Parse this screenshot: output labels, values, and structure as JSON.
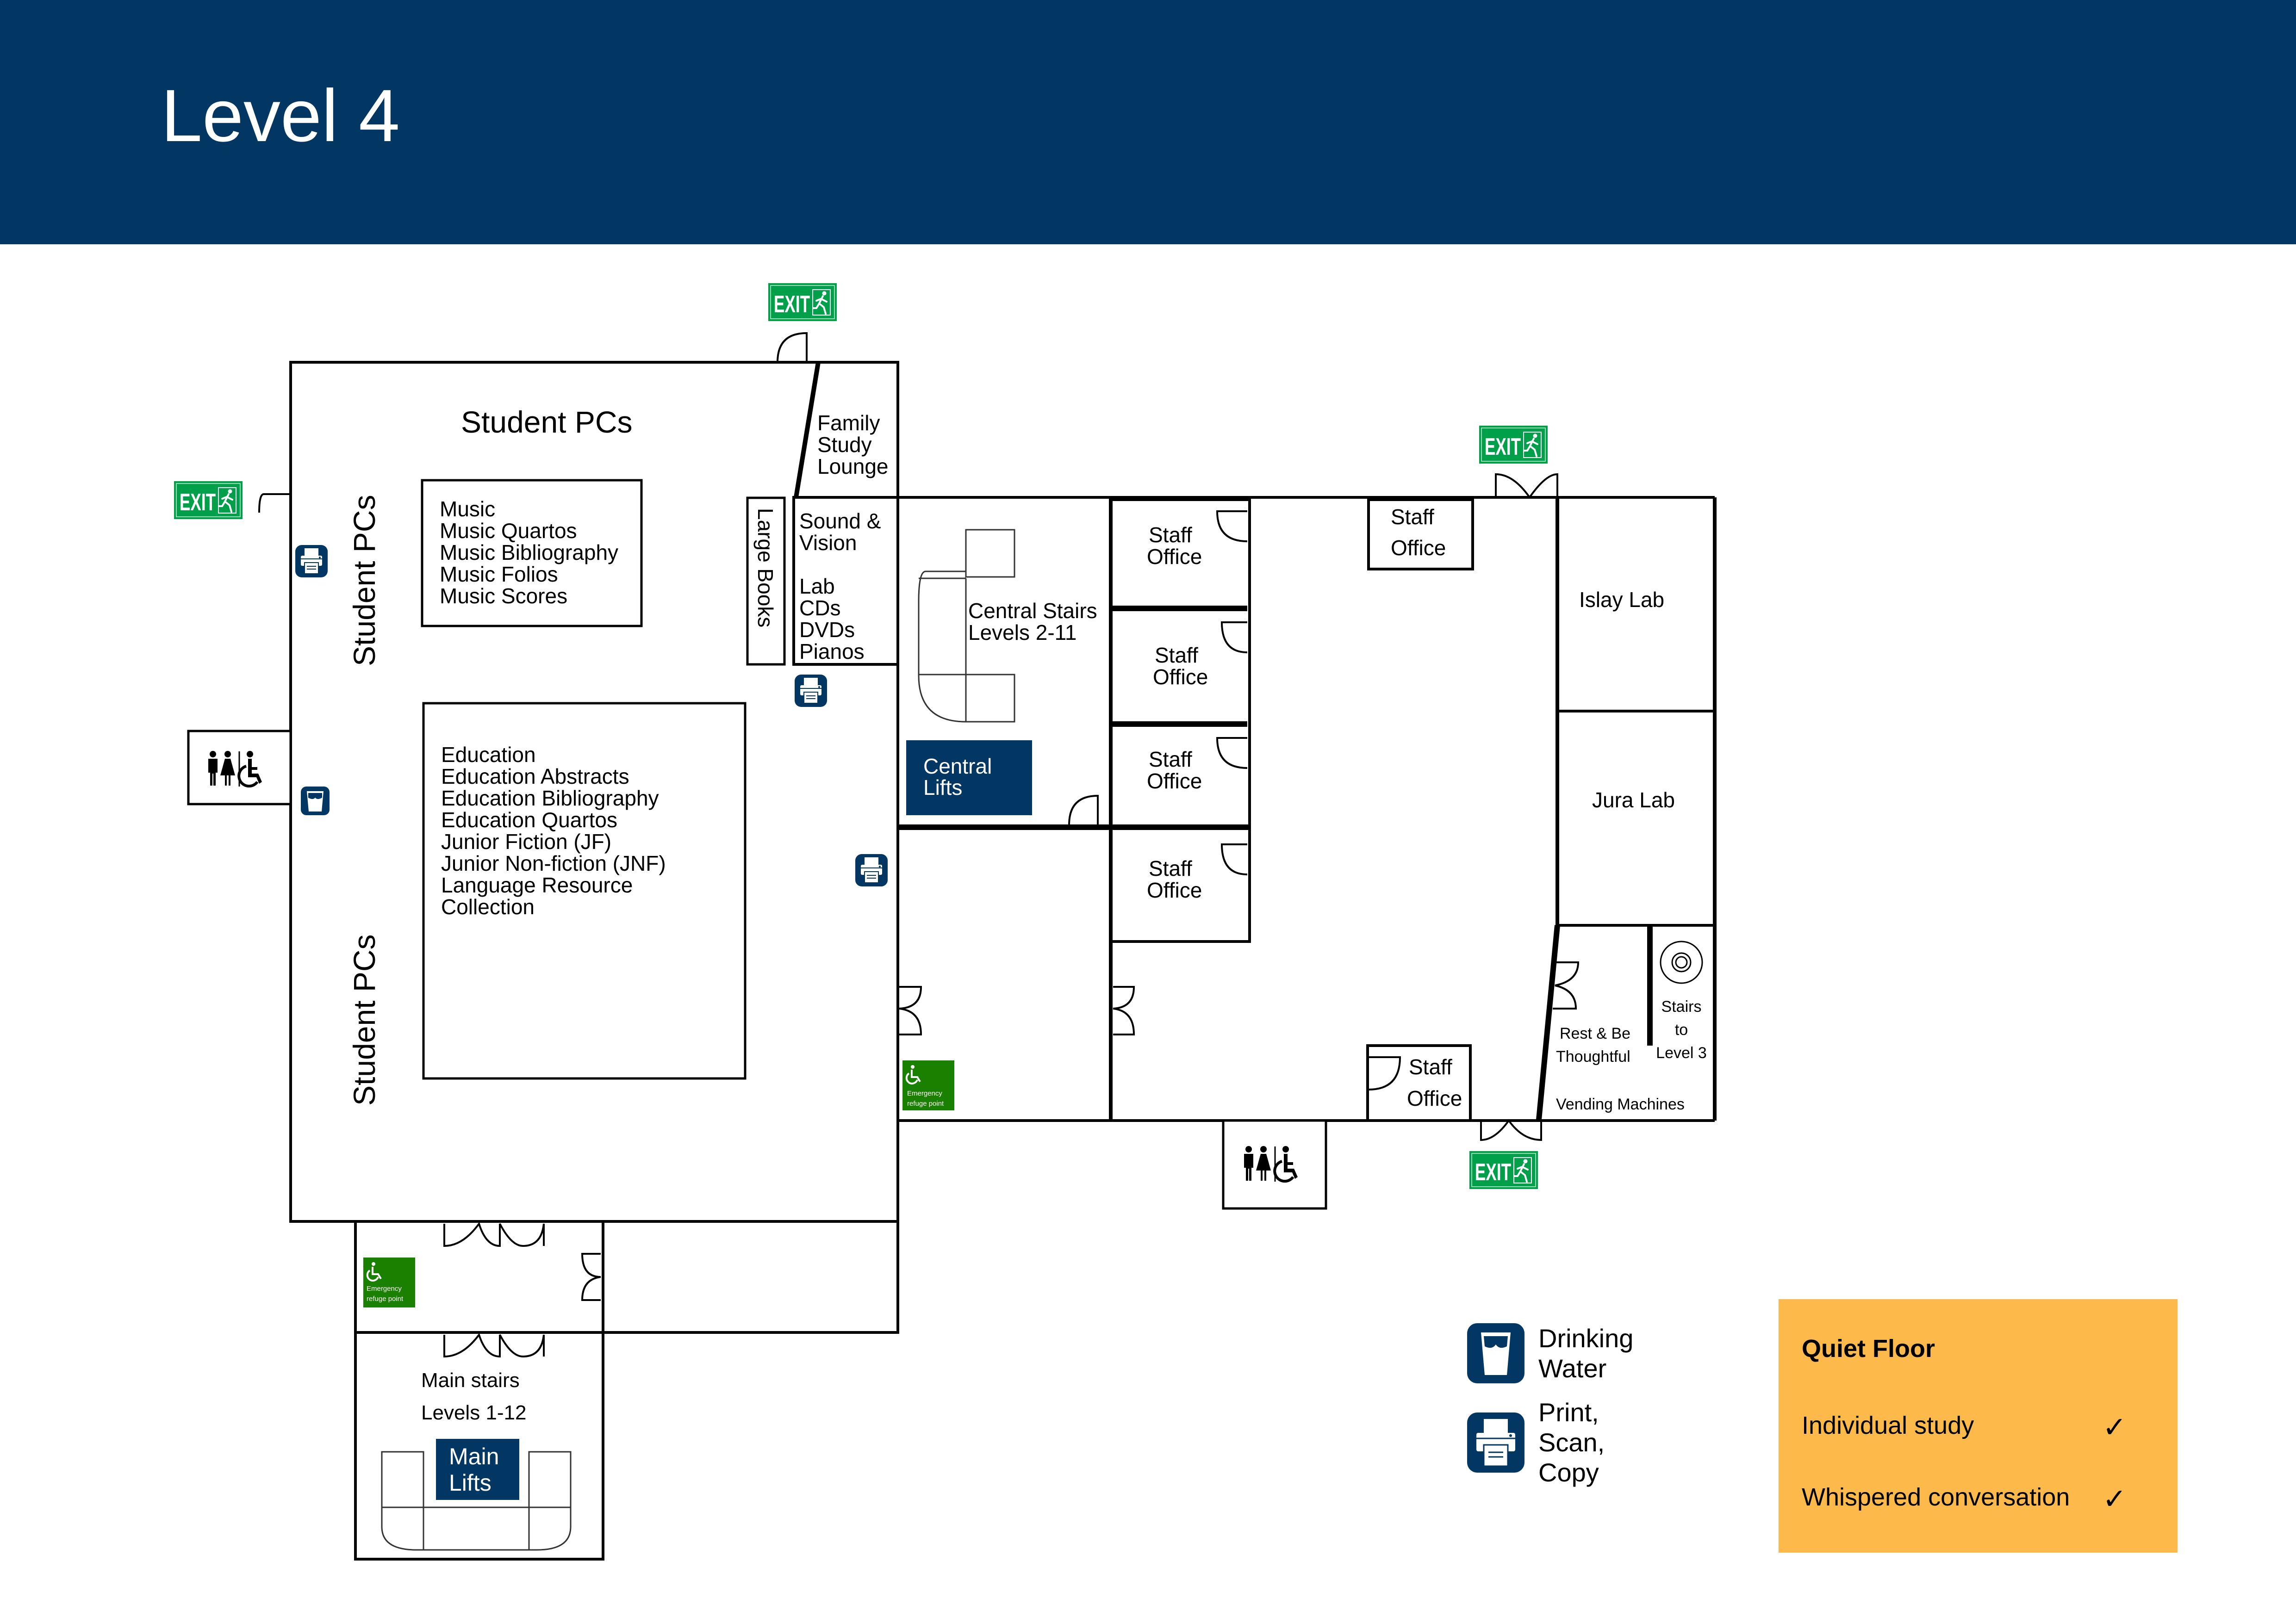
{
  "header": {
    "title": "Level 4"
  },
  "colors": {
    "header_bg": "#023764",
    "exit_green": "#00A04A",
    "refuge_green": "#1A8000",
    "lift_navy": "#023764",
    "quiet_orange": "#FDB94A"
  },
  "west_wing": {
    "student_pcs_top": "Student PCs",
    "student_pcs_left_upper": "Student PCs",
    "student_pcs_left_lower": "Student PCs",
    "music_collection": [
      "Music",
      "Music Quartos",
      "Music Bibliography",
      "Music Folios",
      "Music Scores"
    ],
    "education_collection": [
      "Education",
      "Education Abstracts",
      "Education Bibliography",
      "Education Quartos",
      "Junior Fiction (JF)",
      "Junior Non-fiction (JNF)",
      "Language Resource",
      "Collection"
    ],
    "family_study_lounge": [
      "Family",
      "Study",
      "Lounge"
    ],
    "large_books": "Large Books",
    "sound_vision": [
      "Sound &",
      "Vision",
      "",
      "Lab",
      "CDs",
      "DVDs",
      "Pianos"
    ]
  },
  "central": {
    "central_stairs": [
      "Central Stairs",
      "Levels 2-11"
    ],
    "central_lifts": [
      "Central",
      "Lifts"
    ],
    "refuge_point": [
      "Emergency",
      "refuge point"
    ]
  },
  "staff_offices": [
    [
      "Staff",
      "Office"
    ],
    [
      "Staff",
      "Office"
    ],
    [
      "Staff",
      "Office"
    ],
    [
      "Staff",
      "Office"
    ],
    [
      "Staff",
      "Office"
    ],
    [
      "Staff",
      "Office"
    ]
  ],
  "east_wing": {
    "islay_lab": "Islay Lab",
    "jura_lab": "Jura Lab",
    "rest_be_thoughtful": [
      "Rest & Be",
      "Thoughtful"
    ],
    "stairs_level3": [
      "Stairs",
      "to",
      "Level 3"
    ],
    "vending": "Vending Machines"
  },
  "south": {
    "refuge_point": [
      "Emergency",
      "refuge point"
    ],
    "main_stairs": [
      "Main stairs",
      "Levels 1-12"
    ],
    "main_lifts": [
      "Main",
      "Lifts"
    ]
  },
  "exit_label": "EXIT",
  "legend": {
    "items": [
      {
        "icon": "drinking-water-icon",
        "label": "Drinking Water"
      },
      {
        "icon": "printer-icon",
        "label": "Print, Scan, Copy"
      }
    ]
  },
  "quiet_floor": {
    "title": "Quiet Floor",
    "rules": [
      {
        "label": "Individual study",
        "allowed": "✓"
      },
      {
        "label": "Whispered conversation",
        "allowed": "✓"
      }
    ]
  }
}
